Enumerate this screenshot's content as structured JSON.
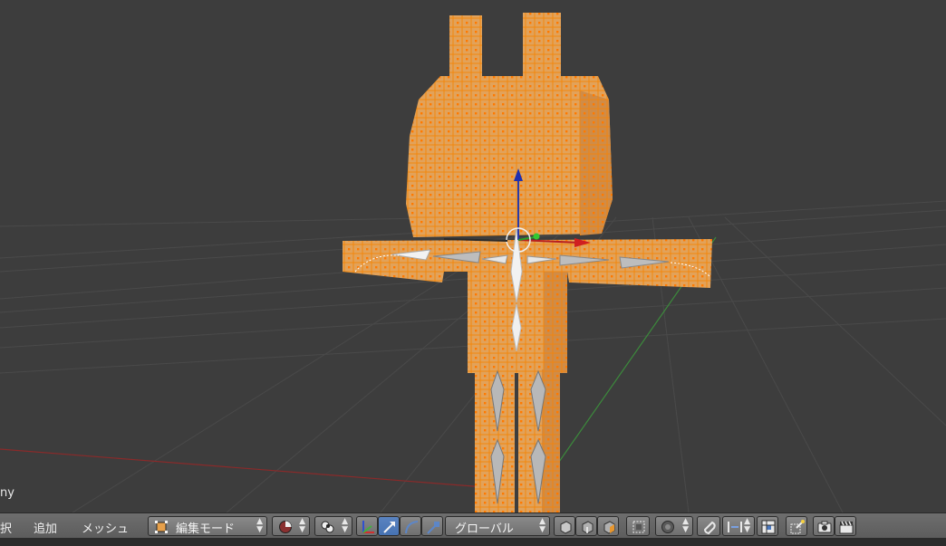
{
  "viewport": {
    "object_label": "ny"
  },
  "header": {
    "menus": [
      {
        "label": "択"
      },
      {
        "label": "追加"
      },
      {
        "label": "メッシュ"
      }
    ],
    "mode_label": "編集モード",
    "orientation_label": "グローバル"
  },
  "colors": {
    "viewport_bg": "#3d3d3d",
    "mesh_face": "#e19a4e",
    "mesh_edge": "#f28a12",
    "vertex": "#ff8c00",
    "header_bg": "#6a6a6a",
    "active_blue": "#5680c2"
  },
  "icons": [
    "mode-cube-icon",
    "viewport-shading-icon",
    "pivot-icon",
    "manipulator-axis-icon",
    "translate-arrow-icon",
    "rotate-icon",
    "scale-icon",
    "vertex-select-icon",
    "edge-select-icon",
    "face-select-icon",
    "occlude-icon",
    "proportional-edit-icon",
    "snap-magnet-icon",
    "snap-element-icon",
    "snap-grid-icon",
    "render-camera-icon",
    "clapboard-icon"
  ]
}
